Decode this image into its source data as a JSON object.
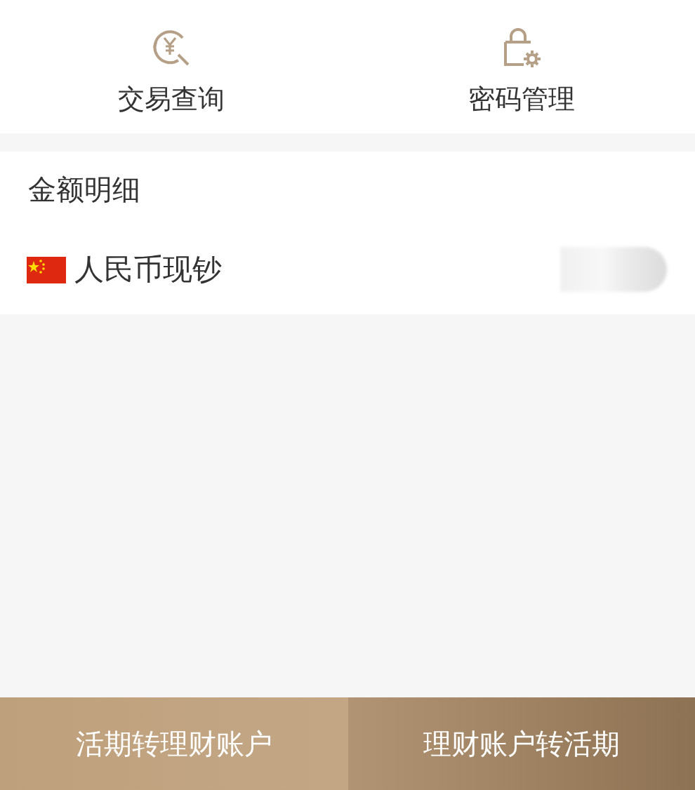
{
  "shortcuts": [
    {
      "kind": "transactions",
      "label": "交易查询"
    },
    {
      "kind": "password",
      "label": "密码管理"
    }
  ],
  "details": {
    "title": "金额明细",
    "rows": [
      {
        "currency": "人民币现钞",
        "amount_hidden": true
      }
    ]
  },
  "actions": [
    {
      "label": "活期转理财账户",
      "kind": "light"
    },
    {
      "label": "理财账户转活期",
      "kind": "dark"
    }
  ]
}
